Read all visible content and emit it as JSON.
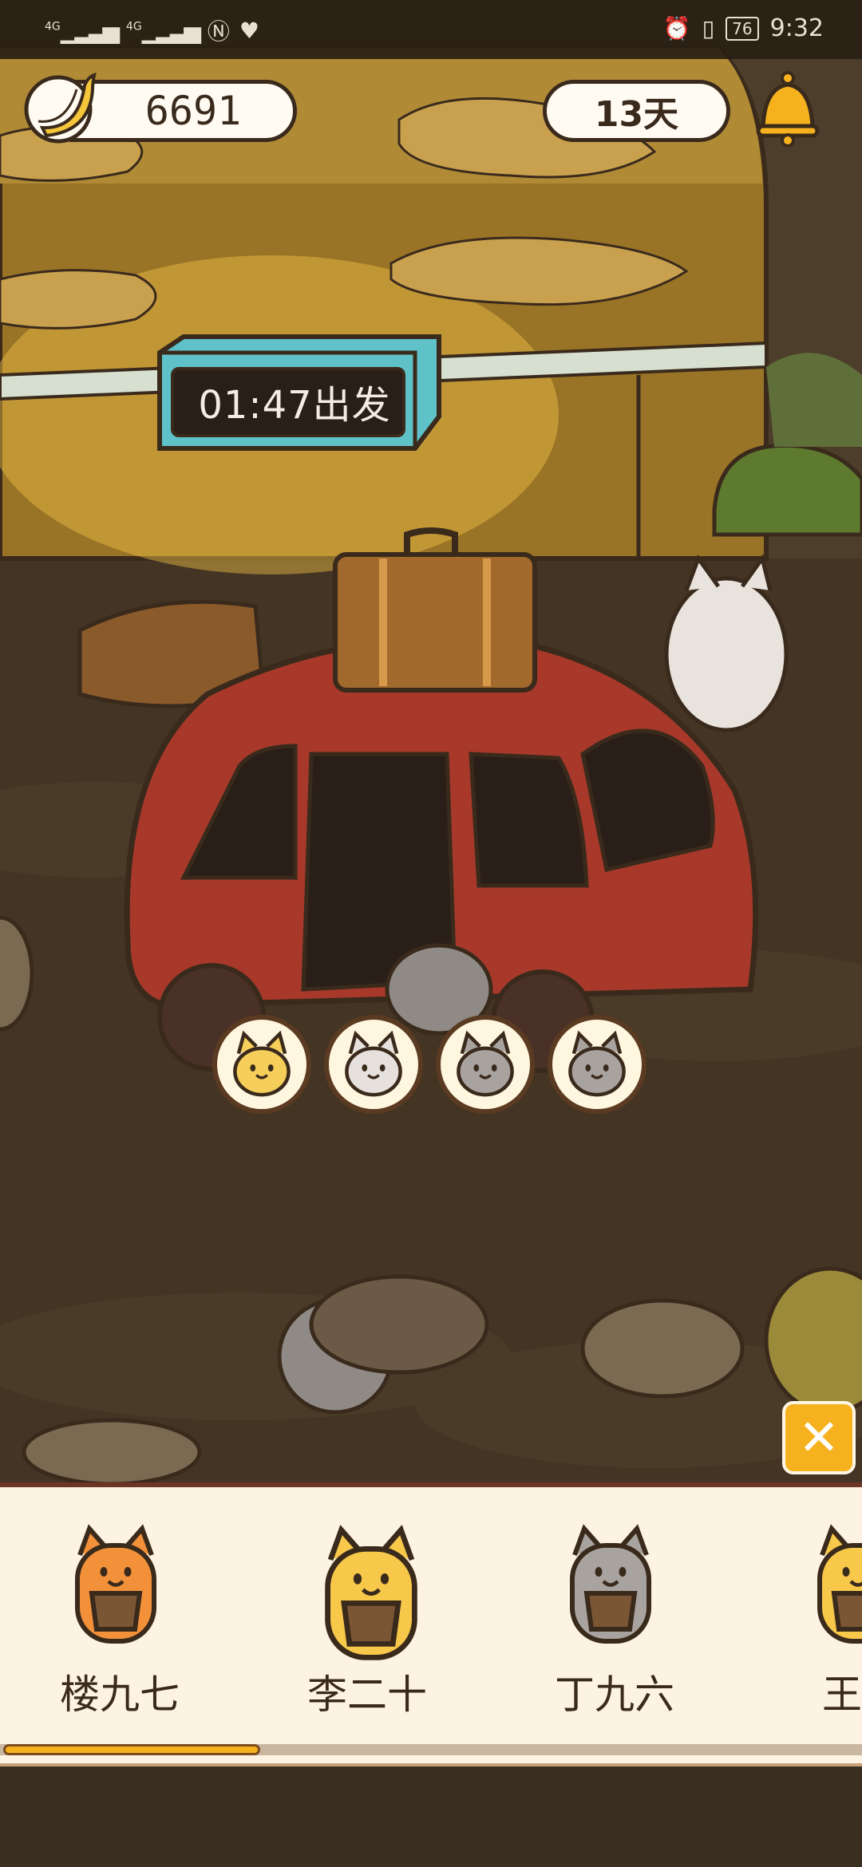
{
  "status_bar": {
    "signal_1_label": "4G",
    "signal_2_label": "4G",
    "battery_level": "76",
    "time": "9:32",
    "icons": [
      "signal-icon",
      "signal-icon",
      "nfc-icon",
      "health-icon",
      "alarm-icon",
      "vibrate-icon",
      "battery-icon"
    ]
  },
  "hud": {
    "coins": "6691",
    "days": "13天",
    "coin_icon": "banana-icon",
    "notification_icon": "bell-icon"
  },
  "station": {
    "departure_label": "01:47出发"
  },
  "car_seats": [
    {
      "cat": "yellow-cat",
      "color": "#f6cf5a"
    },
    {
      "cat": "white-gray-cat",
      "color": "#e6e1dc"
    },
    {
      "cat": "gray-cat",
      "color": "#a9a3a0"
    },
    {
      "cat": "gray-cat",
      "color": "#a9a3a0"
    }
  ],
  "close_button": {
    "icon": "close-icon",
    "label": "✕"
  },
  "cat_tray": {
    "cats": [
      {
        "name": "楼九七",
        "fur": "#f2913a"
      },
      {
        "name": "李二十",
        "fur": "#f7c84a"
      },
      {
        "name": "丁九六",
        "fur": "#a9a3a0"
      },
      {
        "name": "王一",
        "fur": "#f7c84a"
      }
    ]
  },
  "colors": {
    "accent": "#f6b21e",
    "ink": "#3a2a1c",
    "tray_bg": "#fdf3e3",
    "car_red": "#a8392a",
    "sign_teal": "#5fc2c9"
  }
}
